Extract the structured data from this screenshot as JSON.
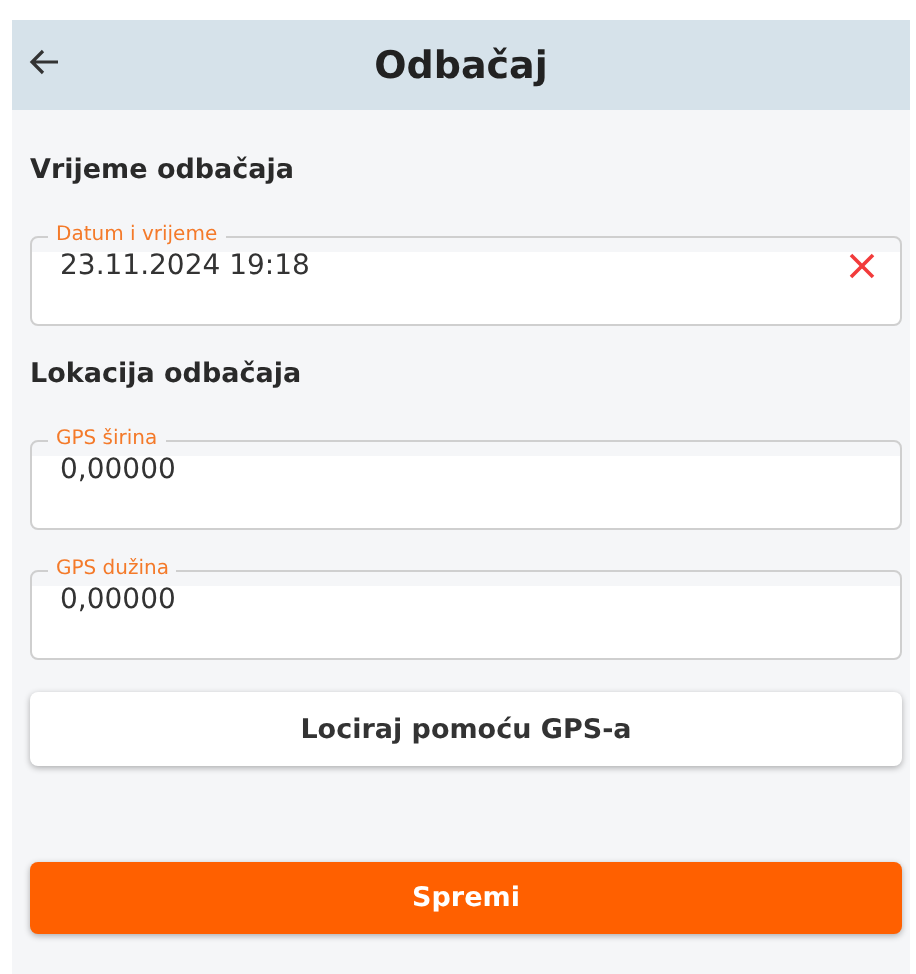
{
  "header": {
    "title": "Odbačaj"
  },
  "sections": [
    {
      "heading": "Vrijeme odbačaja",
      "fields": [
        {
          "label": "Datum i vrijeme",
          "value": "23.11.2024 19:18",
          "clearable": true
        }
      ]
    },
    {
      "heading": "Lokacija odbačaja",
      "fields": [
        {
          "label": "GPS širina",
          "value": "0,00000",
          "clearable": false
        },
        {
          "label": "GPS dužina",
          "value": "0,00000",
          "clearable": false
        }
      ]
    }
  ],
  "locate_button": "Lociraj pomoću GPS-a",
  "save_button": "Spremi"
}
